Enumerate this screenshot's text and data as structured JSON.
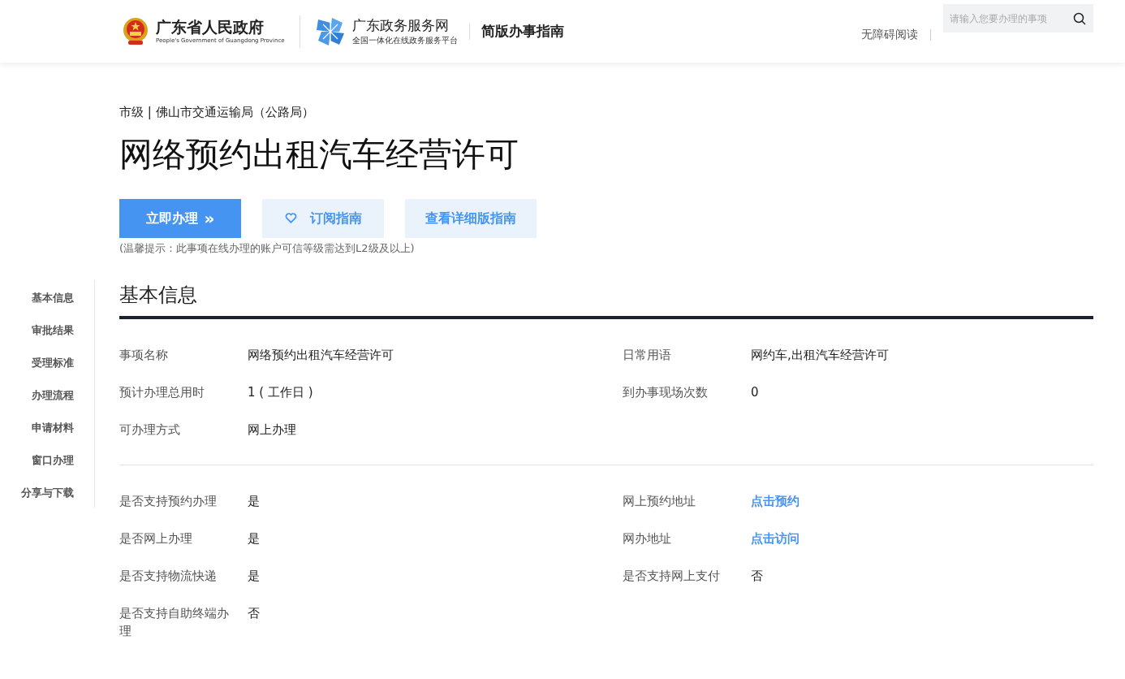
{
  "header": {
    "gov_name": "广东省人民政府",
    "gov_subtitle": "People's Government of Guangdong Province",
    "portal_name": "广东政务服务网",
    "portal_subtitle": "全国一体化在线政务服务平台",
    "page_title": "简版办事指南",
    "accessibility_link": "无障碍阅读",
    "search": {
      "placeholder": "请输入您要办理的事项"
    }
  },
  "breadcrumb": "市级 | 佛山市交通运输局（公路局）",
  "title": "网络预约出租汽车经营许可",
  "actions": [
    {
      "kind": "primary",
      "label": "立即办理",
      "arrow": "»"
    },
    {
      "kind": "subscribe",
      "label": "订阅指南"
    },
    {
      "kind": "secondary",
      "label": "查看详细版指南"
    }
  ],
  "tip": "(温馨提示：此事项在线办理的账户可信等级需达到L2级及以上)",
  "sidebar": {
    "items": [
      {
        "label": "基本信息"
      },
      {
        "label": "审批结果"
      },
      {
        "label": "受理标准"
      },
      {
        "label": "办理流程"
      },
      {
        "label": "申请材料"
      },
      {
        "label": "窗口办理"
      },
      {
        "label": "分享与下载"
      }
    ]
  },
  "section_title": "基本信息",
  "groups": [
    [
      {
        "label": "事项名称",
        "value": "网络预约出租汽车经营许可",
        "kind": "text"
      },
      {
        "label": "日常用语",
        "value": "网约车,出租汽车经营许可",
        "kind": "text"
      },
      {
        "label": "预计办理总用时",
        "value": "1 ( 工作日 )",
        "kind": "text"
      },
      {
        "label": "到办事现场次数",
        "value": "0",
        "kind": "text"
      },
      {
        "label": "可办理方式",
        "value": "网上办理",
        "kind": "text"
      }
    ],
    [
      {
        "label": "是否支持预约办理",
        "value": "是",
        "kind": "text"
      },
      {
        "label": "网上预约地址",
        "value": "点击预约",
        "kind": "link"
      },
      {
        "label": "是否网上办理",
        "value": "是",
        "kind": "text"
      },
      {
        "label": "网办地址",
        "value": "点击访问",
        "kind": "link"
      },
      {
        "label": "是否支持物流快递",
        "value": "是",
        "kind": "text"
      },
      {
        "label": "是否支持网上支付",
        "value": "否",
        "kind": "text"
      },
      {
        "label": "是否支持自助终端办理",
        "value": "否",
        "kind": "text"
      }
    ]
  ]
}
